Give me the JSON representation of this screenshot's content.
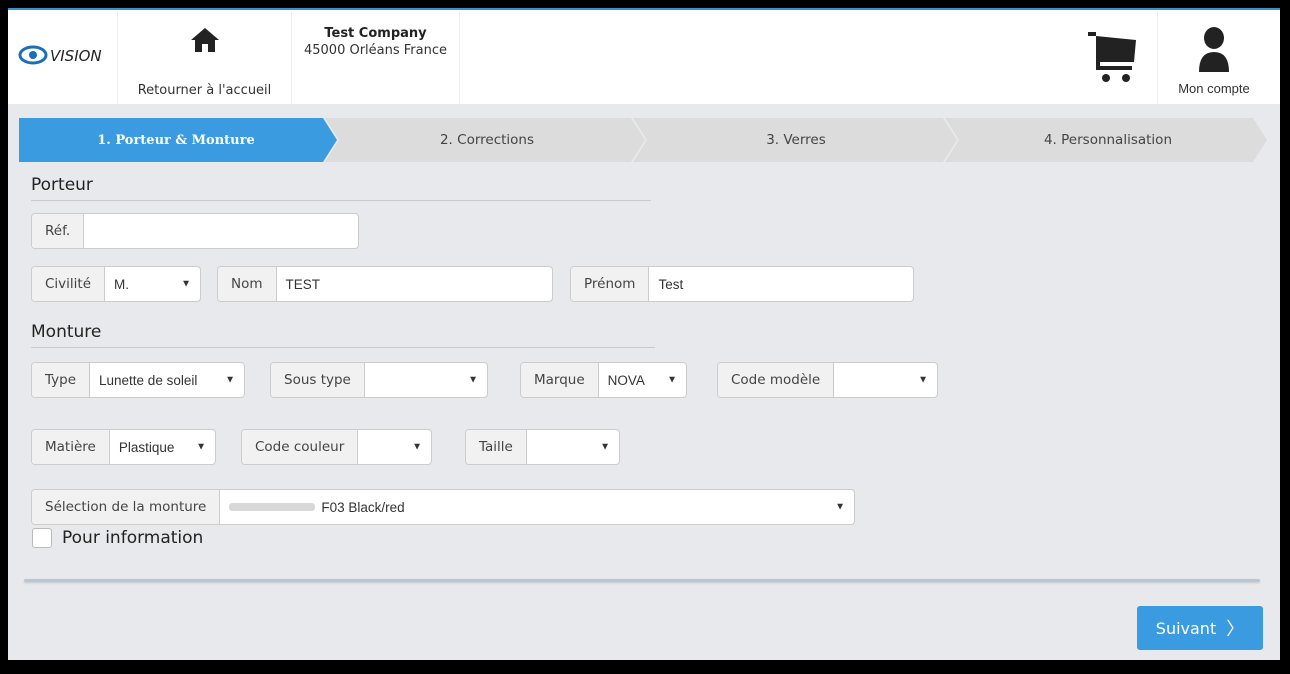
{
  "header": {
    "logo_text": "VISION",
    "home_label": "Retourner à l'accueil",
    "company_name": "Test Company",
    "company_address": "45000 Orléans France",
    "account_label": "Mon compte"
  },
  "steps": [
    {
      "label": "1. Porteur & Monture",
      "active": true
    },
    {
      "label": "2. Corrections",
      "active": false
    },
    {
      "label": "3. Verres",
      "active": false
    },
    {
      "label": "4. Personnalisation",
      "active": false
    }
  ],
  "colors": {
    "accent": "#3a9be0",
    "step_inactive": "#dcdcdc",
    "background": "#e8e9ec"
  },
  "porteur": {
    "title": "Porteur",
    "ref": {
      "label": "Réf.",
      "value": ""
    },
    "civilite": {
      "label": "Civilité",
      "value": "M."
    },
    "nom": {
      "label": "Nom",
      "value": "TEST"
    },
    "prenom": {
      "label": "Prénom",
      "value": "Test"
    }
  },
  "monture": {
    "title": "Monture",
    "type": {
      "label": "Type",
      "value": "Lunette de soleil"
    },
    "sous_type": {
      "label": "Sous type",
      "value": ""
    },
    "marque": {
      "label": "Marque",
      "value": "NOVA"
    },
    "code_modele": {
      "label": "Code modèle",
      "value": ""
    },
    "matiere": {
      "label": "Matière",
      "value": "Plastique"
    },
    "code_couleur": {
      "label": "Code couleur",
      "value": ""
    },
    "taille": {
      "label": "Taille",
      "value": ""
    },
    "selection": {
      "label": "Sélection de la monture",
      "value": "F03 Black/red"
    },
    "pour_information": {
      "label": "Pour information",
      "checked": false
    }
  },
  "actions": {
    "next_label": "Suivant"
  }
}
